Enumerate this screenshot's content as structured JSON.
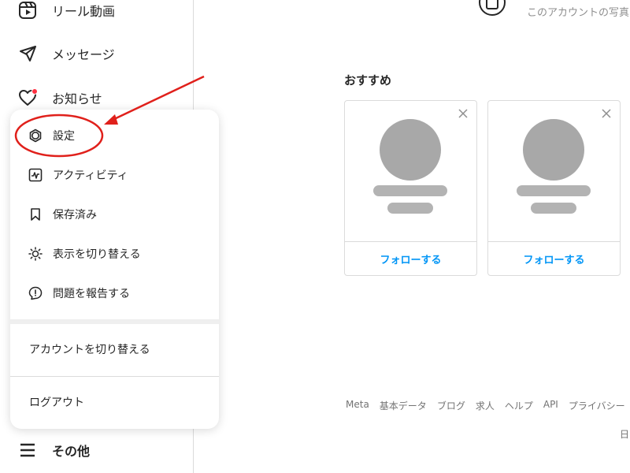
{
  "sidebar": {
    "items": [
      {
        "label": "リール動画",
        "icon": "reels-icon"
      },
      {
        "label": "メッセージ",
        "icon": "paper-plane-icon"
      },
      {
        "label": "お知らせ",
        "icon": "heart-icon"
      }
    ],
    "more_label": "その他"
  },
  "menu": {
    "items": [
      {
        "label": "設定",
        "icon": "gear-icon"
      },
      {
        "label": "アクティビティ",
        "icon": "activity-icon"
      },
      {
        "label": "保存済み",
        "icon": "bookmark-icon"
      },
      {
        "label": "表示を切り替える",
        "icon": "sun-icon"
      },
      {
        "label": "問題を報告する",
        "icon": "report-icon"
      }
    ],
    "switch_account": "アカウントを切り替える",
    "logout": "ログアウト"
  },
  "main": {
    "top_caption": "このアカウントの写真",
    "suggest_title": "おすすめ",
    "cards": [
      {
        "follow_label": "フォローする"
      },
      {
        "follow_label": "フォローする"
      }
    ]
  },
  "footer": {
    "links": [
      "Meta",
      "基本データ",
      "ブログ",
      "求人",
      "ヘルプ",
      "API",
      "プライバシー"
    ],
    "lang": "日"
  },
  "colors": {
    "accent": "#0095f6",
    "annotation_red": "#e0201b",
    "notification": "#ff3040"
  }
}
